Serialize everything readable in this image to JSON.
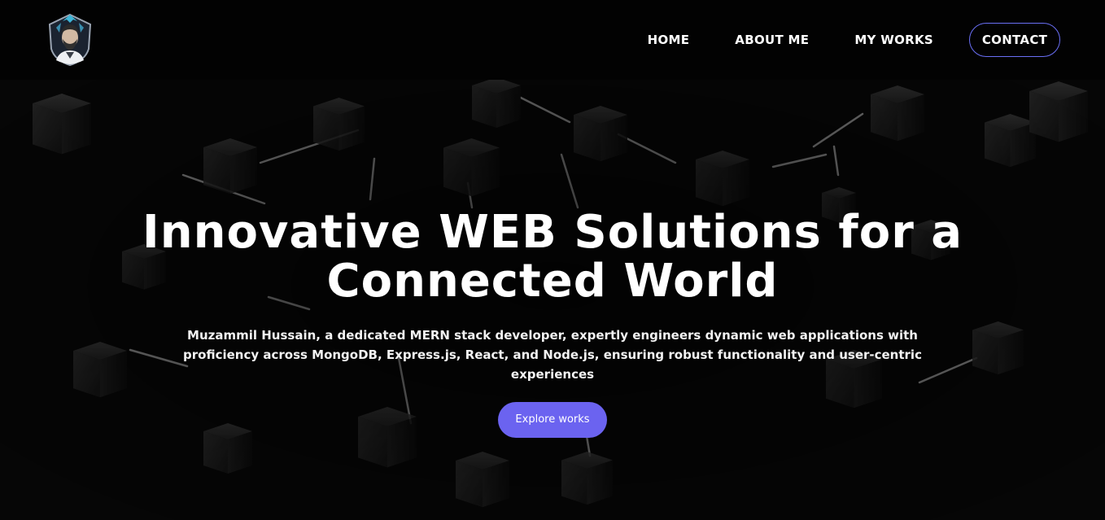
{
  "header": {
    "logo_icon": "developer-avatar-logo-icon",
    "nav": {
      "home": "HOME",
      "about": "ABOUT ME",
      "works": "MY WORKS",
      "contact": "CONTACT"
    }
  },
  "hero": {
    "title": "Innovative WEB Solutions for a Connected World",
    "subtitle": "Muzammil Hussain, a dedicated MERN stack developer, expertly engineers dynamic web applications with proficiency across MongoDB, Express.js, React, and Node.js, ensuring robust functionality and user-centric experiences",
    "cta_label": "Explore works"
  },
  "colors": {
    "accent": "#6b63f0",
    "contact_border": "#6a6ff5",
    "background": "#060606"
  }
}
